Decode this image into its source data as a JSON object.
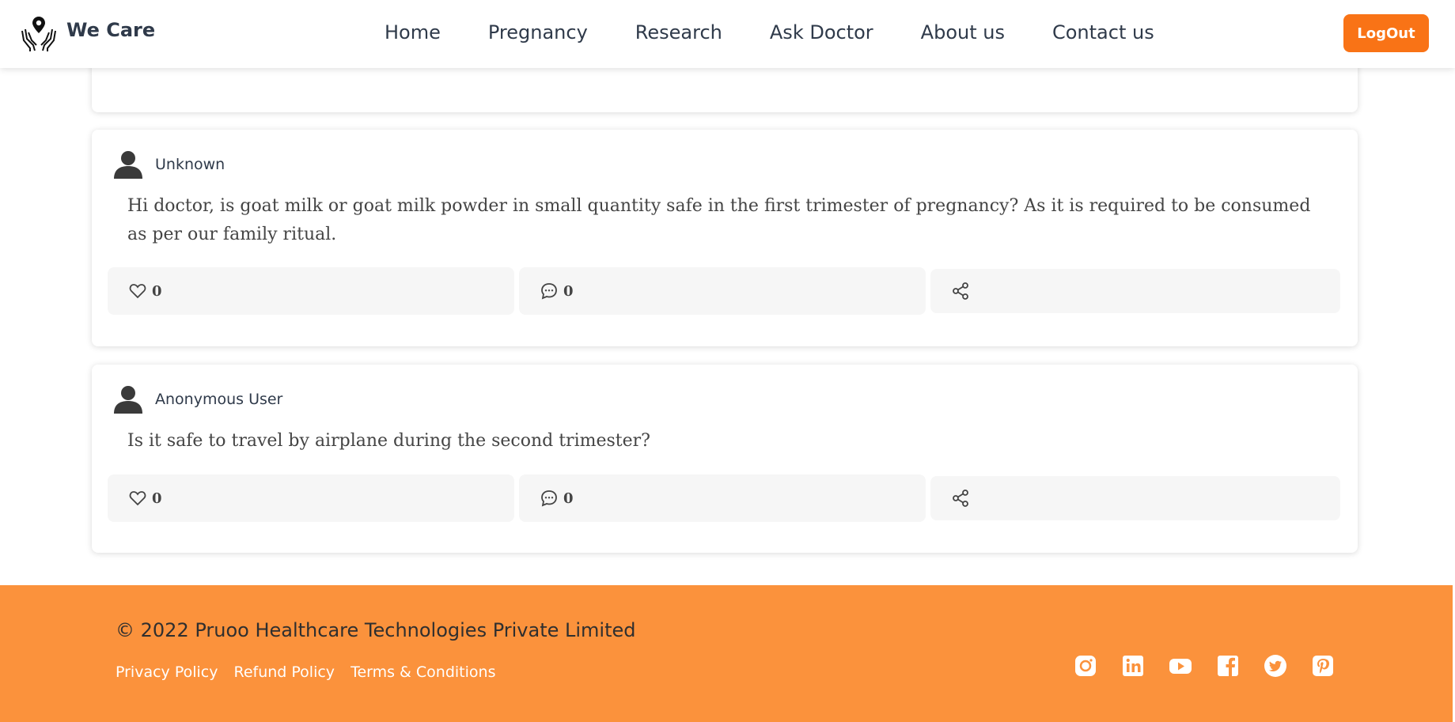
{
  "brand": {
    "name": "We Care"
  },
  "nav": {
    "items": [
      "Home",
      "Pregnancy",
      "Research",
      "Ask Doctor",
      "About us",
      "Contact us"
    ],
    "logout_label": "LogOut"
  },
  "colors": {
    "accent": "#f97316",
    "footer_bg": "#fb923c"
  },
  "posts": [
    {
      "author": "Unknown",
      "question": "Hi doctor, is goat milk or goat milk powder in small quantity safe in the first trimester of pregnancy? As it is required to be consumed as per our family ritual.",
      "likes": "0",
      "comments": "0"
    },
    {
      "author": "Anonymous User",
      "question": "Is it safe to travel by airplane during the second trimester?",
      "likes": "0",
      "comments": "0"
    }
  ],
  "footer": {
    "copyright": "© 2022 Pruoo Healthcare Technologies Private Limited",
    "links": [
      "Privacy Policy",
      "Refund Policy",
      "Terms & Conditions"
    ],
    "socials": [
      "instagram-icon",
      "linkedin-icon",
      "youtube-icon",
      "facebook-icon",
      "twitter-icon",
      "pinterest-icon"
    ]
  }
}
